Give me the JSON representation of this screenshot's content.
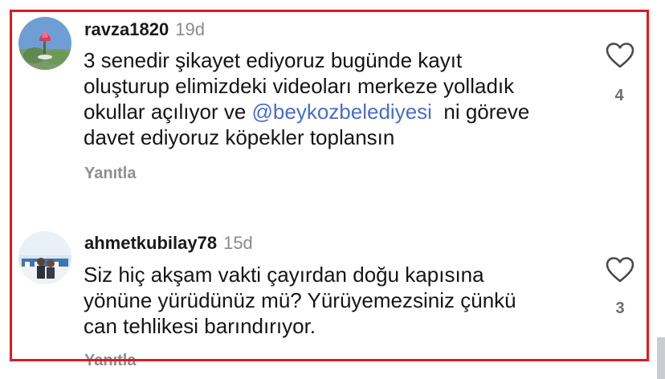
{
  "comments": [
    {
      "username": "ravza1820",
      "age": "19d",
      "lines": [
        {
          "text": "3 senedir şikayet ediyoruz bugünde kayıt"
        },
        {
          "text": "oluşturup elimizdeki videoları merkeze yolladık"
        },
        {
          "pre": "okullar açılıyor ve ",
          "mention": "@beykozbelediyesi",
          "post": "  ni göreve"
        },
        {
          "text": "davet ediyoruz köpekler toplansın"
        }
      ],
      "reply_label": "Yanıtla",
      "likes": "4"
    },
    {
      "username": "ahmetkubilay78",
      "age": "15d",
      "lines": [
        {
          "text": "Siz hiç akşam vakti çayırdan doğu kapısına"
        },
        {
          "text": "yönüne yürüdünüz mü? Yürüyemezsiniz çünkü"
        },
        {
          "text": "can tehlikesi barındırıyor."
        }
      ],
      "reply_label": "Yanıtla",
      "likes": "3"
    }
  ],
  "colors": {
    "highlight_border": "#e0191f",
    "mention": "#4a6dc7",
    "secondary_text": "#8e8e8e"
  },
  "icons": [
    "heart-icon"
  ]
}
